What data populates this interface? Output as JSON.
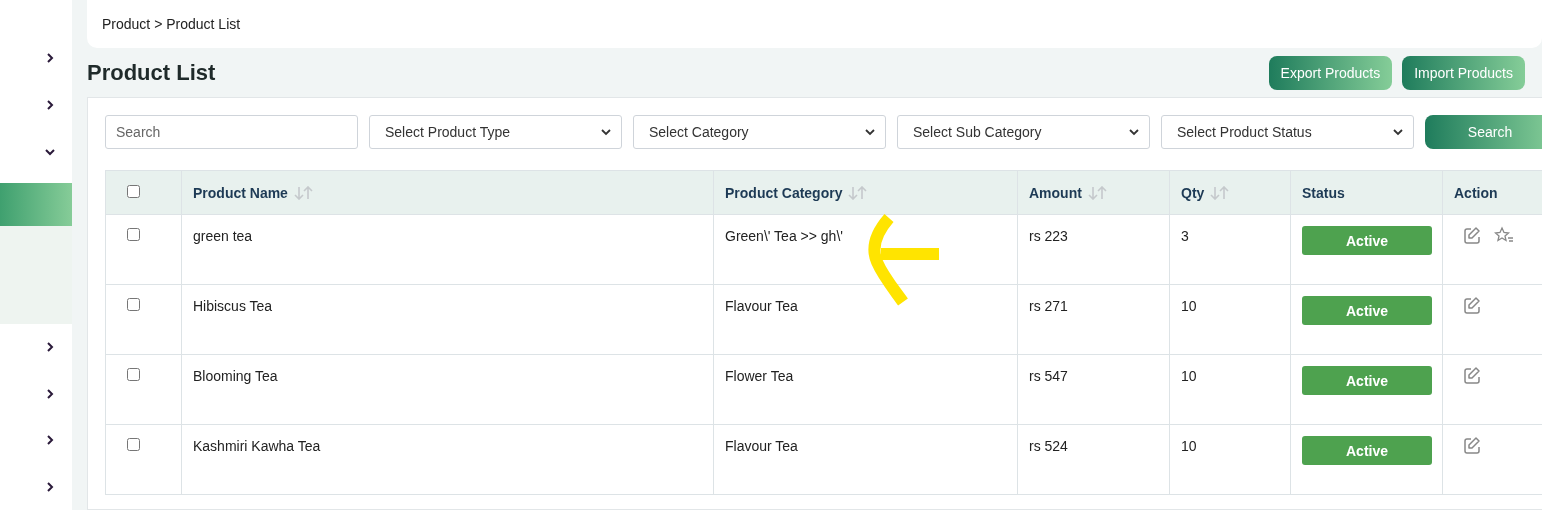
{
  "sidebar": {
    "items": [
      {
        "expanded": false
      },
      {
        "expanded": false
      },
      {
        "expanded": true,
        "children": [
          {
            "selected": true
          },
          {
            "selected": false
          }
        ]
      },
      {
        "expanded": false
      },
      {
        "expanded": false
      },
      {
        "expanded": false
      },
      {
        "expanded": false
      }
    ]
  },
  "breadcrumb": "Product > Product List",
  "page_title": "Product List",
  "header_buttons": [
    "Export Products",
    "Import Products"
  ],
  "filters": {
    "search": {
      "placeholder": "Search"
    },
    "selects": [
      "Select Product Type",
      "Select Category",
      "Select Sub Category",
      "Select Product Status"
    ],
    "search_button": "Search"
  },
  "table": {
    "columns": [
      {
        "label": "Product Name",
        "sortable": true
      },
      {
        "label": "Product Category",
        "sortable": true
      },
      {
        "label": "Amount",
        "sortable": true
      },
      {
        "label": "Qty",
        "sortable": true
      },
      {
        "label": "Status",
        "sortable": false
      },
      {
        "label": "Action",
        "sortable": false
      }
    ],
    "header_checked": false,
    "rows": [
      {
        "checked": false,
        "name": "green tea",
        "category": "Green\\' Tea >> gh\\'",
        "amount": "rs 223",
        "qty": "3",
        "status": {
          "label": "Active",
          "kind": "active"
        },
        "actions": [
          {
            "kind": "edit"
          },
          {
            "kind": "feature"
          }
        ]
      },
      {
        "checked": false,
        "name": "Hibiscus Tea",
        "category": "Flavour Tea",
        "amount": "rs 271",
        "qty": "10",
        "status": {
          "label": "Active",
          "kind": "active"
        },
        "actions": [
          {
            "kind": "edit"
          }
        ]
      },
      {
        "checked": false,
        "name": "Blooming Tea",
        "category": "Flower Tea",
        "amount": "rs 547",
        "qty": "10",
        "status": {
          "label": "Active",
          "kind": "active"
        },
        "actions": [
          {
            "kind": "edit"
          }
        ]
      },
      {
        "checked": false,
        "name": "Kashmiri Kawha Tea",
        "category": "Flavour Tea",
        "amount": "rs 524",
        "qty": "10",
        "status": {
          "label": "Active",
          "kind": "active"
        },
        "actions": [
          {
            "kind": "edit"
          }
        ]
      }
    ]
  }
}
